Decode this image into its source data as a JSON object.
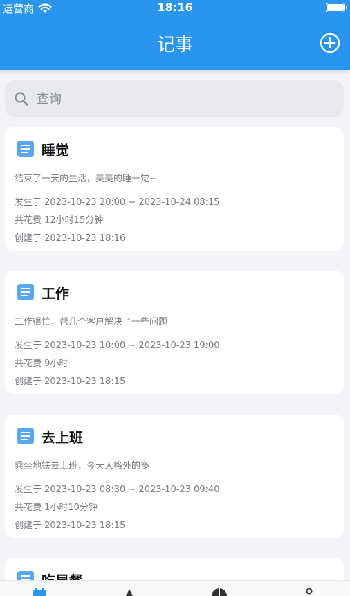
{
  "status_bar": {
    "carrier": "运营商",
    "time": "18:16"
  },
  "header": {
    "title": "记事"
  },
  "search": {
    "placeholder": "查询"
  },
  "notes": [
    {
      "title": "睡觉",
      "description": "结束了一天的生活，美美的睡一觉~",
      "occurred": "发生于 2023-10-23 20:00 ~ 2023-10-24 08:15",
      "duration": "共花费 12小时15分钟",
      "created": "创建于 2023-10-23 18:16"
    },
    {
      "title": "工作",
      "description": "工作很忙，帮几个客户解决了一些问题",
      "occurred": "发生于 2023-10-23 10:00 ~ 2023-10-23 19:00",
      "duration": "共花费 9小时",
      "created": "创建于 2023-10-23 18:15"
    },
    {
      "title": "去上班",
      "description": "乘坐地铁去上班，今天人格外的多",
      "occurred": "发生于 2023-10-23 08:30 ~ 2023-10-23 09:40",
      "duration": "共花费 1小时10分钟",
      "created": "创建于 2023-10-23 18:15"
    },
    {
      "title": "吃早餐"
    }
  ],
  "colors": {
    "primary": "#2a95ef",
    "doc_icon": "#5aa9f0",
    "background": "#f2f4f7"
  },
  "tab_icons": [
    "calendar-icon",
    "triangle-icon",
    "pie-chart-icon",
    "person-icon"
  ]
}
